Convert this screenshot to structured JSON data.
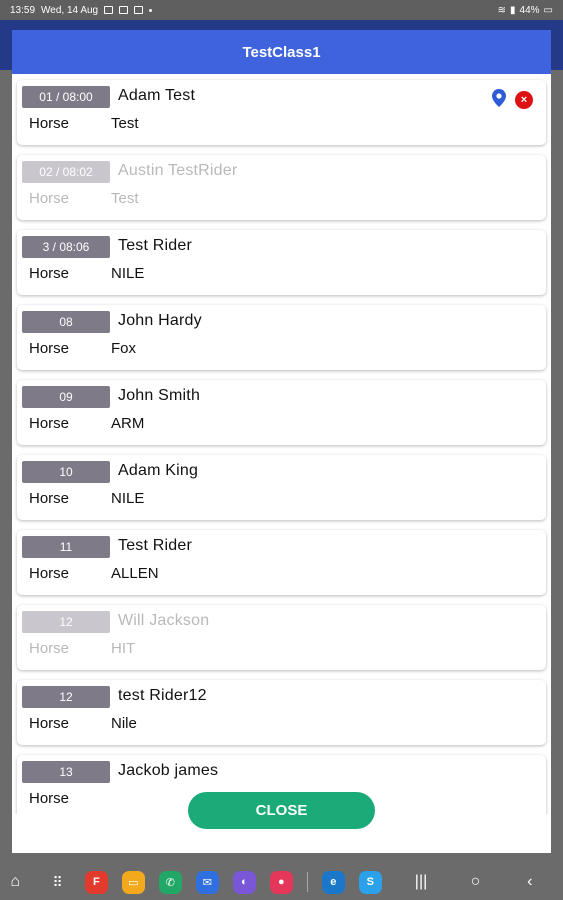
{
  "status_bar": {
    "time": "13:59",
    "date": "Wed, 14 Aug",
    "battery": "44%"
  },
  "dialog": {
    "title": "TestClass1",
    "close_label": "CLOSE"
  },
  "entries": [
    {
      "badge": "01 / 08:00",
      "rider": "Adam Test",
      "horse_label": "Horse",
      "horse": "Test",
      "disabled": false,
      "has_actions": true
    },
    {
      "badge": "02 / 08:02",
      "rider": "Austin TestRider",
      "horse_label": "Horse",
      "horse": "Test",
      "disabled": true,
      "has_actions": false
    },
    {
      "badge": "3 / 08:06",
      "rider": "Test Rider",
      "horse_label": "Horse",
      "horse": "NILE",
      "disabled": false,
      "has_actions": false
    },
    {
      "badge": "08",
      "rider": "John Hardy",
      "horse_label": "Horse",
      "horse": "Fox",
      "disabled": false,
      "has_actions": false
    },
    {
      "badge": "09",
      "rider": "John Smith",
      "horse_label": "Horse",
      "horse": "ARM",
      "disabled": false,
      "has_actions": false
    },
    {
      "badge": "10",
      "rider": "Adam King",
      "horse_label": "Horse",
      "horse": "NILE",
      "disabled": false,
      "has_actions": false
    },
    {
      "badge": "11",
      "rider": "Test Rider",
      "horse_label": "Horse",
      "horse": "ALLEN",
      "disabled": false,
      "has_actions": false
    },
    {
      "badge": "12",
      "rider": "Will Jackson",
      "horse_label": "Horse",
      "horse": "HIT",
      "disabled": true,
      "has_actions": false
    },
    {
      "badge": "12",
      "rider": "test Rider12",
      "horse_label": "Horse",
      "horse": "Nile",
      "disabled": false,
      "has_actions": false
    },
    {
      "badge": "13",
      "rider": "Jackob james",
      "horse_label": "Horse",
      "horse": "",
      "disabled": false,
      "has_actions": false
    }
  ],
  "icons": {
    "location": "location-pin-icon",
    "remove": "remove-icon"
  },
  "colors": {
    "header": "#3f63dd",
    "badge": "#7f7a87",
    "badge_disabled": "#c9c7cd",
    "close_button": "#1aab78",
    "remove": "#dd1111",
    "pin": "#2f5bd6"
  },
  "nav_apps": [
    {
      "name": "flipboard-app-icon",
      "color": "#e23b2e",
      "glyph": "F"
    },
    {
      "name": "files-app-icon",
      "color": "#f2a91c",
      "glyph": "▭"
    },
    {
      "name": "phone-app-icon",
      "color": "#21a867",
      "glyph": "✆"
    },
    {
      "name": "messages-app-icon",
      "color": "#2f6fe0",
      "glyph": "✉"
    },
    {
      "name": "browser-app-icon",
      "color": "#7a57d6",
      "glyph": "◐"
    },
    {
      "name": "screen-recorder-app-icon",
      "color": "#e5375a",
      "glyph": "●"
    },
    {
      "name": "edge-app-icon",
      "color": "#1a77c9",
      "glyph": "e"
    },
    {
      "name": "skype-app-icon",
      "color": "#2aa1e8",
      "glyph": "S"
    }
  ]
}
